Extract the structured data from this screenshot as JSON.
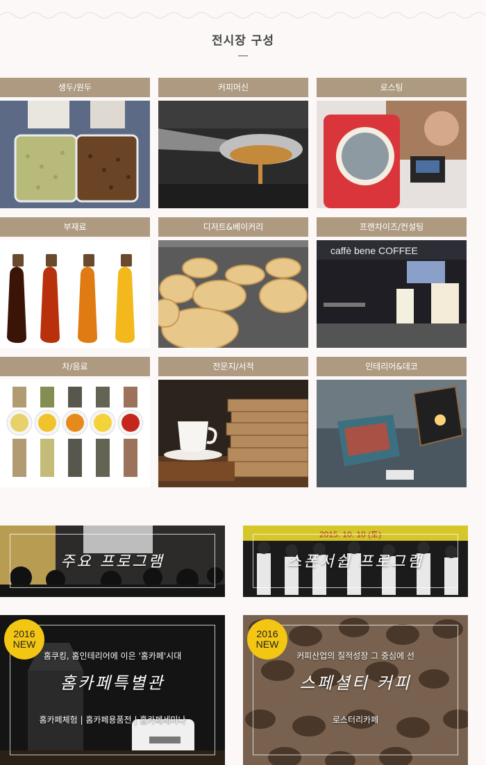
{
  "section": {
    "title": "전시장 구성"
  },
  "tiles": [
    {
      "label": "생두/원두"
    },
    {
      "label": "커피머신"
    },
    {
      "label": "로스팅"
    },
    {
      "label": "부재료"
    },
    {
      "label": "디저트&베이커리"
    },
    {
      "label": "프랜차이즈/컨설팅"
    },
    {
      "label": "차/음료"
    },
    {
      "label": "전문지/서적"
    },
    {
      "label": "인테리어&데코"
    }
  ],
  "banners": {
    "main_program": {
      "title": "주요 프로그램"
    },
    "sponsor_program": {
      "title": "스폰서쉽 프로그램"
    },
    "home_cafe": {
      "badge_year": "2016",
      "badge_new": "NEW",
      "tagline": "홈쿠킹, 홈인테리어에 이은 '홈카페'시대",
      "title": "홈카페특별관",
      "links": "홈카페체험 | 홈카페용품전 | 홈카페세미나"
    },
    "specialty": {
      "badge_year": "2016",
      "badge_new": "NEW",
      "tagline": "커피산업의 질적성장 그 중심에 선",
      "title": "스페셜티 커피",
      "links": "로스터리카페"
    }
  },
  "colors": {
    "header_bg": "#ad9a80",
    "badge": "#f3c613",
    "page_bg": "#fdf8f8"
  }
}
